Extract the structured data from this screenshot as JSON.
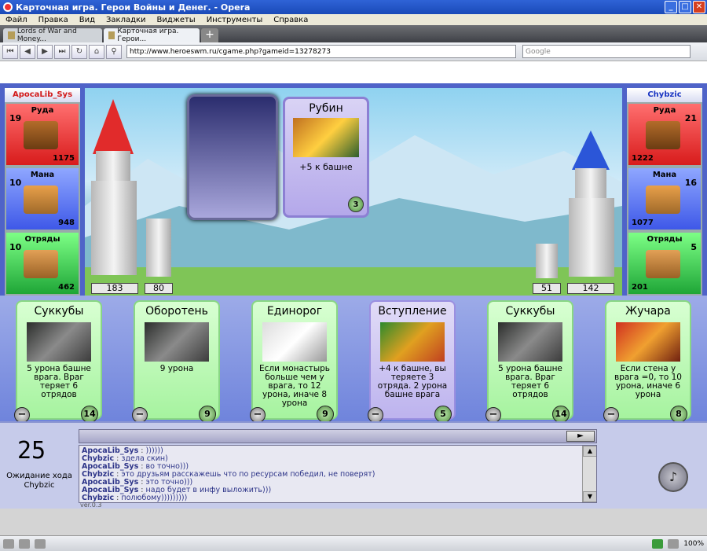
{
  "window": {
    "title": "Карточная игра. Герои Войны и Денег. - Opera",
    "minimize": "_",
    "maximize": "□",
    "close": "✕"
  },
  "menu": [
    "Файл",
    "Правка",
    "Вид",
    "Закладки",
    "Виджеты",
    "Инструменты",
    "Справка"
  ],
  "tabs": [
    {
      "label": "Lords of War and Money..."
    },
    {
      "label": "Карточная игра. Герои..."
    }
  ],
  "newtab": "+",
  "toolbar": {
    "url": "http://www.heroeswm.ru/cgame.php?gameid=13278273",
    "search_placeholder": "Google"
  },
  "players": {
    "left": {
      "name": "ApocaLib_Sys",
      "ore": {
        "label": "Руда",
        "gain": "19",
        "amount": "1175"
      },
      "mana": {
        "label": "Мана",
        "gain": "10",
        "amount": "948"
      },
      "troops": {
        "label": "Отряды",
        "gain": "10",
        "amount": "462"
      },
      "tower": "183",
      "wall": "80"
    },
    "right": {
      "name": "Chybzic",
      "ore": {
        "label": "Руда",
        "gain": "21",
        "amount": "1222"
      },
      "mana": {
        "label": "Мана",
        "gain": "16",
        "amount": "1077"
      },
      "troops": {
        "label": "Отряды",
        "gain": "5",
        "amount": "201"
      },
      "tower": "142",
      "wall": "51"
    }
  },
  "played_card": {
    "name": "Рубин",
    "desc": "+5 к башне",
    "cost": "3"
  },
  "hand": [
    {
      "name": "Суккубы",
      "desc": "5 урона башне врага. Враг теряет 6 отрядов",
      "cost": "14",
      "color": "green"
    },
    {
      "name": "Оборотень",
      "desc": "9 урона",
      "cost": "9",
      "color": "green"
    },
    {
      "name": "Единорог",
      "desc": "Если монастырь больше чем у врага, то 12 урона, иначе 8 урона",
      "cost": "9",
      "color": "green"
    },
    {
      "name": "Вступление",
      "desc": "+4 к башне, вы теряете 3 отряда. 2 урона башне врага",
      "cost": "5",
      "color": "blue"
    },
    {
      "name": "Суккубы",
      "desc": "5 урона башне врага. Враг теряет 6 отрядов",
      "cost": "14",
      "color": "green"
    },
    {
      "name": "Жучара",
      "desc": "Если стена у врага =0, то 10 урона, иначе 6 урона",
      "cost": "8",
      "color": "green"
    }
  ],
  "discard_symbol": "−",
  "turn": {
    "timer": "25",
    "waiting_label": "Ожидание хода",
    "waiting_player": "Chybzic"
  },
  "chat": {
    "send": "►",
    "messages": [
      {
        "who": "ApocaLib_Sys",
        "text": "))))))"
      },
      {
        "who": "Chybzic",
        "text": "здела скин)"
      },
      {
        "who": "ApocaLib_Sys",
        "text": "во точно)))"
      },
      {
        "who": "Chybzic",
        "text": "это друзьям расскажешь что по ресурсам победил, не поверят)"
      },
      {
        "who": "ApocaLib_Sys",
        "text": "это точно)))"
      },
      {
        "who": "ApocaLib_Sys",
        "text": "надо будет в инфу выложить)))"
      },
      {
        "who": "Chybzic",
        "text": "полюбому)))))))))"
      }
    ],
    "version": "ver.0.3"
  },
  "status": {
    "zoom": "100%"
  }
}
